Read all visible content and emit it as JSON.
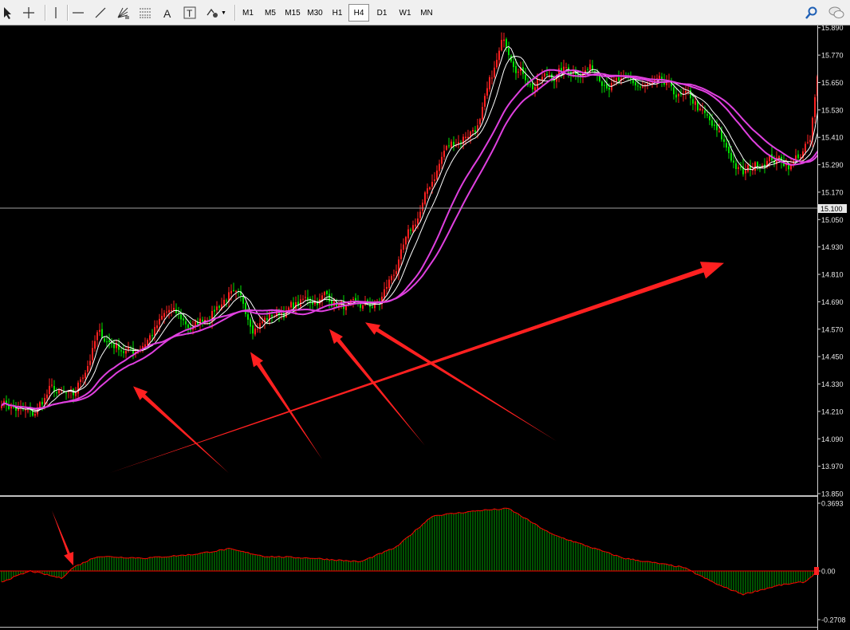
{
  "toolbar": {
    "tools": [
      {
        "name": "cursor-arrow-icon"
      },
      {
        "name": "crosshair-icon"
      },
      {
        "name": "vertical-line-icon"
      },
      {
        "name": "horizontal-line-icon"
      },
      {
        "name": "trendline-icon"
      },
      {
        "name": "gann-fan-icon"
      },
      {
        "name": "fibonacci-icon"
      },
      {
        "name": "text-tool-icon"
      },
      {
        "name": "text-label-icon"
      },
      {
        "name": "shapes-dropdown-icon"
      }
    ],
    "timeframes": [
      "M1",
      "M5",
      "M15",
      "M30",
      "H1",
      "H4",
      "D1",
      "W1",
      "MN"
    ],
    "active_timeframe": "H4",
    "right_icons": [
      "search-icon",
      "chat-icon"
    ]
  },
  "price_axis": {
    "labels": [
      "15.890",
      "15.770",
      "15.650",
      "15.530",
      "15.410",
      "15.290",
      "15.170",
      "15.050",
      "14.930",
      "14.810",
      "14.690",
      "14.570",
      "14.450",
      "14.330",
      "14.210",
      "14.090",
      "13.970",
      "13.850"
    ],
    "current_price": "15.100"
  },
  "indicator_axis": {
    "max_label": "0.3693",
    "zero_label": "0.00",
    "min_label": "-0.2708"
  },
  "colors": {
    "bull": "#ff2020",
    "bear": "#00e000",
    "ma_fast": "#ffffff",
    "ma_slow": "#e040e0",
    "arrow": "#ff2020",
    "histogram": "#00a000",
    "histogram_line": "#ff0000"
  },
  "chart_data": {
    "type": "candlestick",
    "price_range": [
      13.85,
      15.91
    ],
    "current_price": 15.1,
    "price_path": [
      {
        "bar": 0,
        "price": 14.26
      },
      {
        "bar": 13,
        "price": 14.18
      },
      {
        "bar": 20,
        "price": 14.3
      },
      {
        "bar": 30,
        "price": 14.25
      },
      {
        "bar": 40,
        "price": 14.54
      },
      {
        "bar": 55,
        "price": 14.47
      },
      {
        "bar": 70,
        "price": 14.64
      },
      {
        "bar": 80,
        "price": 14.57
      },
      {
        "bar": 95,
        "price": 14.73
      },
      {
        "bar": 105,
        "price": 14.6
      },
      {
        "bar": 120,
        "price": 14.66
      },
      {
        "bar": 135,
        "price": 14.72
      },
      {
        "bar": 148,
        "price": 14.64
      },
      {
        "bar": 158,
        "price": 14.68
      },
      {
        "bar": 172,
        "price": 15.0
      },
      {
        "bar": 185,
        "price": 15.35
      },
      {
        "bar": 200,
        "price": 15.48
      },
      {
        "bar": 210,
        "price": 15.83
      },
      {
        "bar": 222,
        "price": 15.65
      },
      {
        "bar": 235,
        "price": 15.7
      },
      {
        "bar": 245,
        "price": 15.72
      },
      {
        "bar": 262,
        "price": 15.63
      },
      {
        "bar": 275,
        "price": 15.62
      },
      {
        "bar": 290,
        "price": 15.55
      },
      {
        "bar": 300,
        "price": 15.4
      },
      {
        "bar": 310,
        "price": 15.24
      },
      {
        "bar": 320,
        "price": 15.33
      },
      {
        "bar": 330,
        "price": 15.3
      },
      {
        "bar": 338,
        "price": 15.38
      },
      {
        "bar": 342,
        "price": 15.73
      }
    ],
    "moving_averages": [
      {
        "name": "MA fast",
        "color": "white"
      },
      {
        "name": "MA medium",
        "color": "white"
      },
      {
        "name": "MA slow 1",
        "color": "magenta"
      },
      {
        "name": "MA slow 2",
        "color": "magenta"
      }
    ],
    "indicator": {
      "type": "histogram",
      "range": [
        -0.2708,
        0.3693
      ],
      "path": [
        {
          "bar": 0,
          "value": -0.06
        },
        {
          "bar": 12,
          "value": 0.0
        },
        {
          "bar": 25,
          "value": -0.04
        },
        {
          "bar": 30,
          "value": 0.02
        },
        {
          "bar": 40,
          "value": 0.08
        },
        {
          "bar": 60,
          "value": 0.07
        },
        {
          "bar": 80,
          "value": 0.09
        },
        {
          "bar": 95,
          "value": 0.12
        },
        {
          "bar": 110,
          "value": 0.08
        },
        {
          "bar": 130,
          "value": 0.07
        },
        {
          "bar": 150,
          "value": 0.05
        },
        {
          "bar": 165,
          "value": 0.13
        },
        {
          "bar": 180,
          "value": 0.3
        },
        {
          "bar": 200,
          "value": 0.33
        },
        {
          "bar": 212,
          "value": 0.34
        },
        {
          "bar": 230,
          "value": 0.2
        },
        {
          "bar": 260,
          "value": 0.07
        },
        {
          "bar": 285,
          "value": 0.02
        },
        {
          "bar": 300,
          "value": -0.08
        },
        {
          "bar": 310,
          "value": -0.13
        },
        {
          "bar": 325,
          "value": -0.08
        },
        {
          "bar": 336,
          "value": -0.06
        },
        {
          "bar": 342,
          "value": 0.01
        }
      ]
    },
    "annotations": {
      "arrows": [
        {
          "from": [
            45,
            13.94
          ],
          "to": [
            302,
            14.86
          ],
          "kind": "long-trend-arrow"
        },
        {
          "from": [
            95,
            13.94
          ],
          "to": [
            55,
            14.32
          ],
          "kind": "support-arrow"
        },
        {
          "from": [
            134,
            14.0
          ],
          "to": [
            104,
            14.47
          ],
          "kind": "support-arrow"
        },
        {
          "from": [
            177,
            14.06
          ],
          "to": [
            137,
            14.57
          ],
          "kind": "support-arrow"
        },
        {
          "from": [
            232,
            14.08
          ],
          "to": [
            152,
            14.6
          ],
          "kind": "support-arrow"
        }
      ],
      "indicator_arrow": {
        "from": [
          21,
          0.33
        ],
        "to": [
          30,
          0.03
        ],
        "kind": "cross-arrow"
      }
    }
  }
}
